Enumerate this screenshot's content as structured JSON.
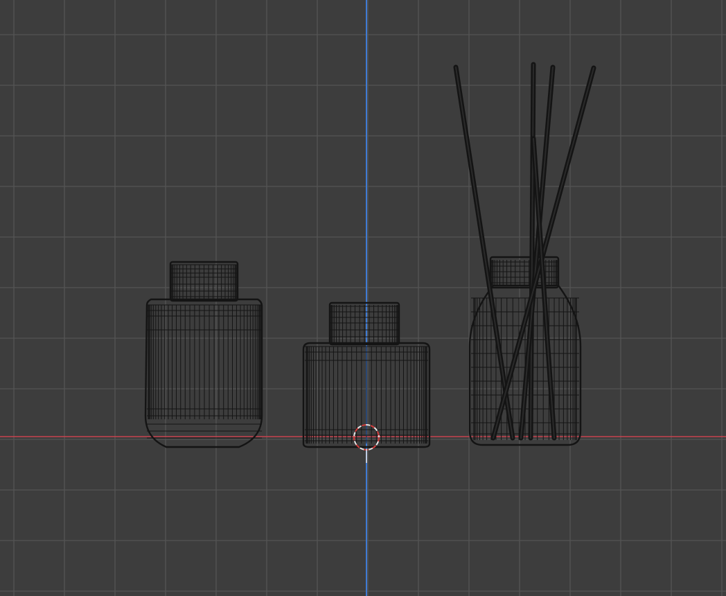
{
  "viewport": {
    "view": "front-orthographic",
    "shading": "wireframe",
    "colors": {
      "background": "#3d3d3d",
      "grid": "#545454",
      "x_axis": "#c8434f",
      "z_axis": "#3f7bd3",
      "wire": "#141414",
      "cursor_red": "#d43b3b",
      "cursor_white": "#e8e8e8"
    }
  },
  "objects": [
    {
      "name": "bottle-round-capped",
      "kind": "bottle",
      "cap": true,
      "reeds": 0
    },
    {
      "name": "bottle-square-capped",
      "kind": "bottle",
      "cap": true,
      "reeds": 0
    },
    {
      "name": "reed-diffuser",
      "kind": "bottle",
      "cap": true,
      "reeds": 5
    }
  ],
  "icons": {
    "cursor": "3d-cursor-icon"
  }
}
